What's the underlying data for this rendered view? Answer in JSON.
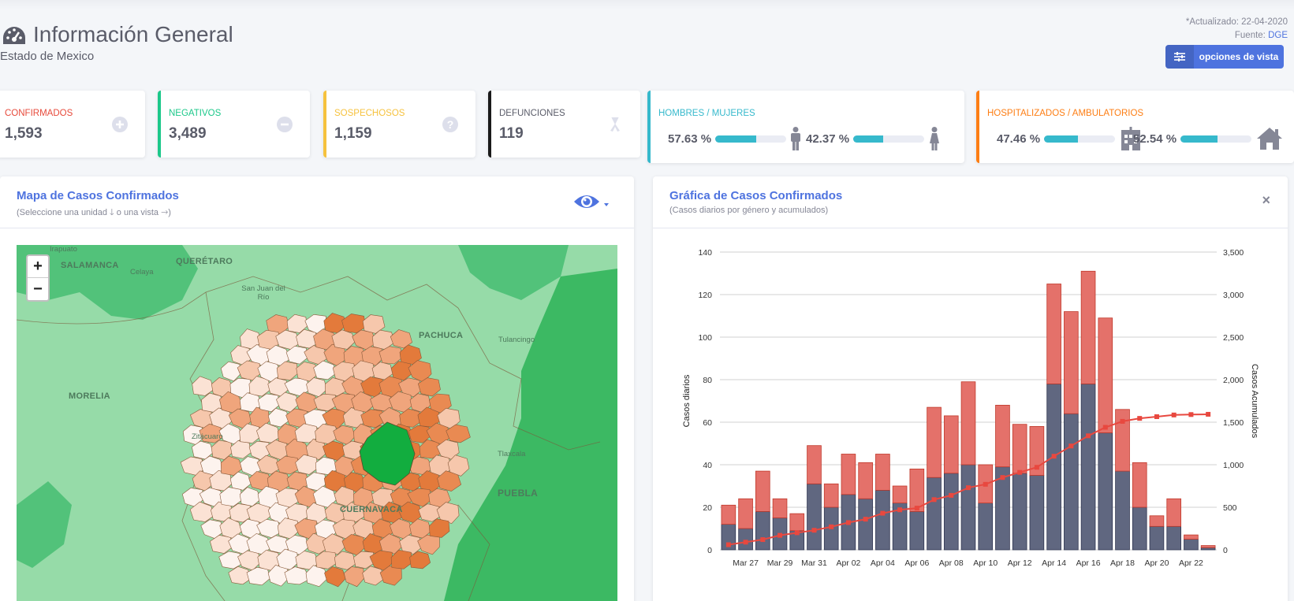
{
  "header": {
    "title": "Información General",
    "subtitle": "Estado de Mexico",
    "updated": "*Actualizado: 22-04-2020",
    "source_prefix": "Fuente: ",
    "source_link": "DGE",
    "options_button": "opciones de vista"
  },
  "cards": {
    "confirmados": {
      "label": "Confirmados",
      "value": "1,593",
      "color": "#e74a3b",
      "icon": "plus-circle-icon"
    },
    "negativos": {
      "label": "Negativos",
      "value": "3,489",
      "color": "#1cc88a",
      "icon": "minus-circle-icon"
    },
    "sospechosos": {
      "label": "Sospechosos",
      "value": "1,159",
      "color": "#f6c23e",
      "icon": "question-circle-icon"
    },
    "defunciones": {
      "label": "Defunciones",
      "value": "119",
      "color": "#1a1a1a",
      "icon": "ribbon-icon"
    },
    "genero": {
      "label": "Hombres / Mujeres",
      "men_pct": "57.63 %",
      "men_value": 0.5763,
      "women_pct": "42.37 %",
      "women_value": 0.4237,
      "color": "#36b9cc"
    },
    "hospital": {
      "label": "Hospitalizados / Ambulatorios",
      "hosp_pct": "47.46 %",
      "hosp_value": 0.4746,
      "amb_pct": "52.54 %",
      "amb_value": 0.5254,
      "color": "#fd7e14"
    }
  },
  "map_panel": {
    "title": "Mapa de Casos Confirmados",
    "subtitle": "(Seleccione una unidad 🡓 o una vista 🡒)",
    "zoom_in": "+",
    "zoom_out": "−",
    "labels": [
      "Irapuato",
      "SALAMANCA",
      "Celaya",
      "QUERÉTARO",
      "San Juan del Río",
      "PACHUCA",
      "Tulancingo",
      "MORELIA",
      "Zitácuaro",
      "Tlaxcala",
      "PUEBLA",
      "CUERNAVACA"
    ]
  },
  "chart_panel": {
    "title": "Gráfica de Casos Confirmados",
    "subtitle": "(Casos diarios por género y acumulados)",
    "close": "×"
  },
  "chart_data": {
    "type": "bar",
    "categories": [
      "Mar 26",
      "Mar 27",
      "Mar 28",
      "Mar 29",
      "Mar 30",
      "Mar 31",
      "Apr 01",
      "Apr 02",
      "Apr 03",
      "Apr 04",
      "Apr 05",
      "Apr 06",
      "Apr 07",
      "Apr 08",
      "Apr 09",
      "Apr 10",
      "Apr 11",
      "Apr 12",
      "Apr 13",
      "Apr 14",
      "Apr 15",
      "Apr 16",
      "Apr 17",
      "Apr 18",
      "Apr 19",
      "Apr 20",
      "Apr 21",
      "Apr 22",
      "Apr 23"
    ],
    "tick_labels": [
      "Mar 27",
      "Mar 29",
      "Mar 31",
      "Apr 02",
      "Apr 04",
      "Apr 06",
      "Apr 08",
      "Apr 10",
      "Apr 12",
      "Apr 14",
      "Apr 16",
      "Apr 18",
      "Apr 20",
      "Apr 22"
    ],
    "series": [
      {
        "type": "bar",
        "color": "#606780",
        "values": [
          12,
          10,
          18,
          15,
          9,
          31,
          20,
          26,
          24,
          28,
          22,
          18,
          34,
          36,
          40,
          22,
          39,
          36,
          35,
          78,
          64,
          78,
          55,
          37,
          20,
          11,
          11,
          5,
          1
        ]
      },
      {
        "type": "bar",
        "color": "#e4716a",
        "values": [
          9,
          14,
          19,
          9,
          8,
          18,
          11,
          19,
          17,
          17,
          8,
          20,
          33,
          27,
          39,
          18,
          29,
          23,
          23,
          47,
          48,
          53,
          54,
          29,
          21,
          5,
          13,
          2,
          1
        ]
      },
      {
        "type": "line",
        "color": "#e8483f",
        "values": [
          60,
          90,
          120,
          170,
          200,
          230,
          270,
          320,
          360,
          430,
          470,
          490,
          590,
          640,
          730,
          770,
          850,
          910,
          970,
          1100,
          1220,
          1340,
          1440,
          1510,
          1545,
          1565,
          1585,
          1590,
          1593
        ]
      }
    ],
    "ylabel": "Casos diarios",
    "y2label": "Casos Acumulados",
    "ylim": [
      0,
      140
    ],
    "y2lim": [
      0,
      3500
    ],
    "yticks": [
      0,
      20,
      40,
      60,
      80,
      100,
      120,
      140
    ],
    "y2ticks": [
      "0",
      "500",
      "1,000",
      "1,500",
      "2,000",
      "2,500",
      "3,000",
      "3,500"
    ],
    "stacked": true,
    "grid": true
  }
}
